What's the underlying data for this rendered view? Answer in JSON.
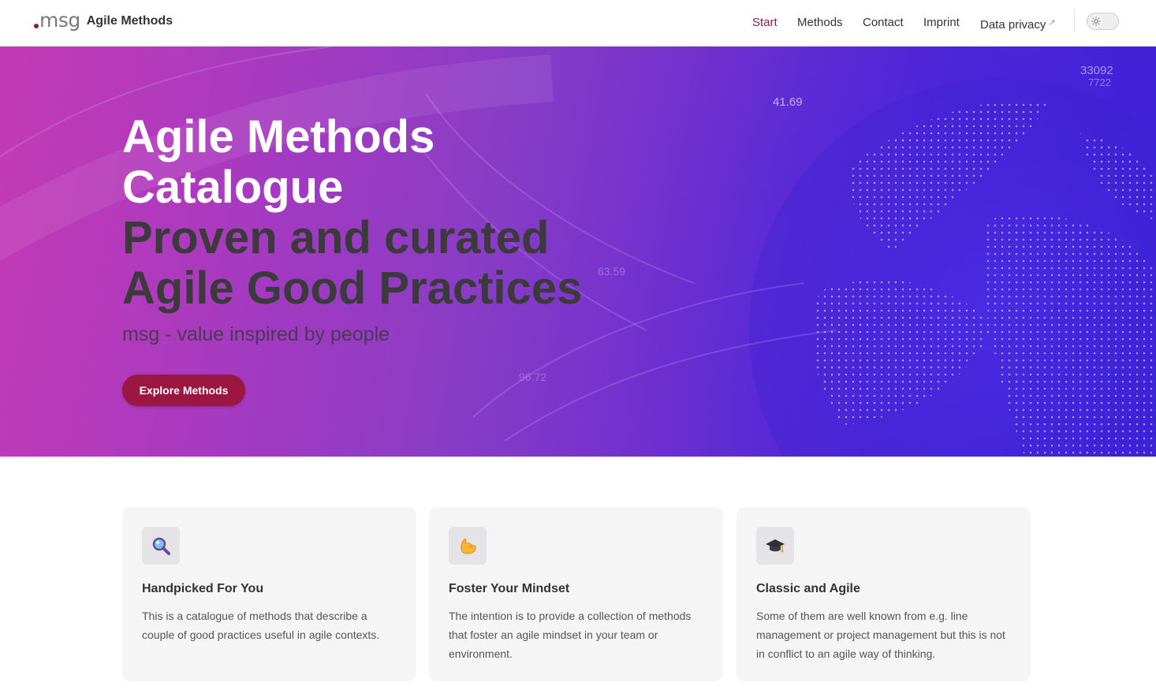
{
  "header": {
    "logo_text": "msg",
    "brand_name": "Agile Methods",
    "nav": [
      {
        "label": "Start",
        "active": true
      },
      {
        "label": "Methods",
        "active": false
      },
      {
        "label": "Contact",
        "active": false
      },
      {
        "label": "Imprint",
        "active": false
      },
      {
        "label": "Data privacy",
        "active": false,
        "external": true
      }
    ],
    "external_icon": "↗",
    "theme_toggle_icon": "sun-icon"
  },
  "hero": {
    "title": "Agile Methods Catalogue",
    "subtitle": "Proven and curated Agile Good Practices",
    "tagline": "msg - value inspired by people",
    "cta_label": "Explore Methods",
    "bg_numbers": [
      "41.69",
      "63.59",
      "96.72",
      "33092",
      "7722"
    ]
  },
  "features": [
    {
      "icon": "magnifying-glass-icon",
      "title": "Handpicked For You",
      "text": "This is a catalogue of methods that describe a couple of good practices useful in agile contexts."
    },
    {
      "icon": "flexed-biceps-icon",
      "title": "Foster Your Mindset",
      "text": "The intention is to provide a collection of methods that foster an agile mindset in your team or environment."
    },
    {
      "icon": "graduation-cap-icon",
      "title": "Classic and Agile",
      "text": "Some of them are well known from e.g. line management or project management but this is not in conflict to an agile way of thinking."
    }
  ],
  "colors": {
    "brand": "#8b1e3f",
    "cta": "#9b1640",
    "hero_start": "#c43ab6",
    "hero_end": "#3a1fd8"
  }
}
